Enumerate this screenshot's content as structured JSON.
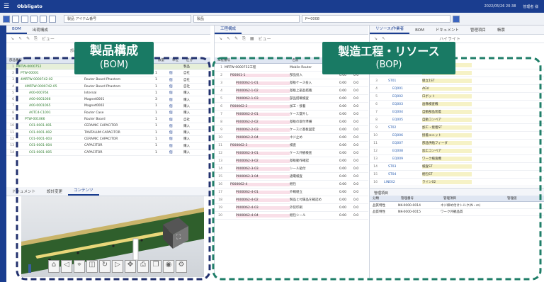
{
  "app": {
    "brand": "Obbligato",
    "status_right": [
      "2022/05/26 20:38",
      "管理者 様"
    ]
  },
  "toolbar": {
    "field1": "製品 アイテム番号",
    "field2": "製品",
    "field3": "P=0008"
  },
  "bom": {
    "tabs": [
      "BOM",
      "出荷構成"
    ],
    "filter_label": "ビュー",
    "section_label": "部品構成",
    "columns": [
      "部品番号",
      "名前",
      "数量",
      "単位",
      "区分"
    ],
    "rows": [
      {
        "n": "1",
        "name": "MRTW-0000752",
        "desc": "",
        "qty": "",
        "unit": "",
        "type": "製品"
      },
      {
        "n": "2",
        "name": "PTW-00001",
        "desc": "Router Lid",
        "qty": "1",
        "unit": "個",
        "type": "自社"
      },
      {
        "n": "3",
        "name": "4MRTW-0000742-02",
        "desc": "Router Board Phantom",
        "qty": "1",
        "unit": "個",
        "type": "自社"
      },
      {
        "n": "4",
        "name": "4MRTW-0000742-05",
        "desc": "Router Board Phantom",
        "qty": "1",
        "unit": "個",
        "type": "自社"
      },
      {
        "n": "5",
        "name": "A00-000764",
        "desc": "Internal",
        "qty": "1",
        "unit": "個",
        "type": "購入"
      },
      {
        "n": "6",
        "name": "A00-0001066",
        "desc": "Magnet0001",
        "qty": "3",
        "unit": "個",
        "type": "購入"
      },
      {
        "n": "7",
        "name": "A00-0001065",
        "desc": "Magnet0002",
        "qty": "1",
        "unit": "個",
        "type": "購入"
      },
      {
        "n": "8",
        "name": "A0TC4-C1001",
        "desc": "Router Case",
        "qty": "1",
        "unit": "個",
        "type": "購入"
      },
      {
        "n": "9",
        "name": "PTW-001066",
        "desc": "Router Board",
        "qty": "1",
        "unit": "個",
        "type": "自社"
      },
      {
        "n": "10",
        "name": "C01-0001-001",
        "desc": "CERAMIC CAPACITOR",
        "qty": "1",
        "unit": "個",
        "type": "購入"
      },
      {
        "n": "11",
        "name": "C01-0001-002",
        "desc": "TANTALUM CAPACITOR",
        "qty": "1",
        "unit": "個",
        "type": "購入"
      },
      {
        "n": "12",
        "name": "C01-0001-003",
        "desc": "CERAMIC CAPACITOR",
        "qty": "1",
        "unit": "個",
        "type": "購入"
      },
      {
        "n": "13",
        "name": "C01-0001-004",
        "desc": "CAPACITOR",
        "qty": "1",
        "unit": "個",
        "type": "購入"
      },
      {
        "n": "14",
        "name": "C01-0001-005",
        "desc": "CAPACITOR",
        "qty": "1",
        "unit": "個",
        "type": "購入"
      }
    ],
    "bottom_tabs": [
      "ドキュメント",
      "設計変更",
      "コンテンツ"
    ]
  },
  "process": {
    "tab": "工程構成",
    "filter_label": "ビュー",
    "columns": [
      "工程番号",
      "名前",
      "作業時間",
      "標準時間"
    ],
    "rows": [
      {
        "n": "1",
        "name": "MRTW-0000752工程",
        "desc": "Mobile Router",
        "a": "",
        "b": ""
      },
      {
        "n": "2",
        "name": "P00001-1",
        "desc": "部品投入",
        "a": "0.00",
        "b": "0.0"
      },
      {
        "n": "3",
        "name": "P000062-1-01",
        "desc": "基板ケース投入",
        "a": "0.00",
        "b": "0.0"
      },
      {
        "n": "4",
        "name": "P000062-1-02",
        "desc": "基板上部品搭載",
        "a": "0.00",
        "b": "0.0"
      },
      {
        "n": "5",
        "name": "P000062-1-03",
        "desc": "部品搭載検査",
        "a": "0.00",
        "b": "0.0"
      },
      {
        "n": "6",
        "name": "P000062-2",
        "desc": "加工・接着",
        "a": "0.00",
        "b": "0.0"
      },
      {
        "n": "7",
        "name": "P000062-2-01",
        "desc": "ケース蓋外し",
        "a": "0.00",
        "b": "0.0"
      },
      {
        "n": "8",
        "name": "P000062-2-02",
        "desc": "基板の取付準備",
        "a": "0.00",
        "b": "0.0"
      },
      {
        "n": "9",
        "name": "P000062-2-03",
        "desc": "ケースに基板固定",
        "a": "0.00",
        "b": "0.0"
      },
      {
        "n": "10",
        "name": "P000062-2-04",
        "desc": "ネジ止め",
        "a": "0.00",
        "b": "0.0"
      },
      {
        "n": "11",
        "name": "P000062-3",
        "desc": "検査",
        "a": "0.00",
        "b": "0.0"
      },
      {
        "n": "12",
        "name": "P000062-3-01",
        "desc": "ケース外観検査",
        "a": "0.00",
        "b": "0.0"
      },
      {
        "n": "13",
        "name": "P000062-3-02",
        "desc": "基板動作確認",
        "a": "0.00",
        "b": "0.0"
      },
      {
        "n": "14",
        "name": "P000062-3-03",
        "desc": "シール貼付",
        "a": "0.00",
        "b": "0.0"
      },
      {
        "n": "15",
        "name": "P000062-3-04",
        "desc": "通電検査",
        "a": "0.00",
        "b": "0.0"
      },
      {
        "n": "16",
        "name": "P000062-4",
        "desc": "梱包",
        "a": "0.00",
        "b": "0.0"
      },
      {
        "n": "17",
        "name": "P000062-4-01",
        "desc": "外箱組立",
        "a": "0.00",
        "b": "0.0"
      },
      {
        "n": "18",
        "name": "P000062-4-02",
        "desc": "製品と付属品を箱詰め",
        "a": "0.00",
        "b": "0.0"
      },
      {
        "n": "19",
        "name": "P000062-4-03",
        "desc": "外装印刷",
        "a": "0.00",
        "b": "0.0"
      },
      {
        "n": "20",
        "name": "P000062-4-04",
        "desc": "梱包シール",
        "a": "0.00",
        "b": "0.0"
      }
    ]
  },
  "resource": {
    "tabs": [
      "リソース/作業者",
      "BOM",
      "ドキュメント",
      "管理項目",
      "帳票"
    ],
    "highlight": "ハイライト",
    "rows": [
      {
        "n": "1",
        "name": "",
        "desc": "工場"
      },
      {
        "n": "2",
        "name": "LINE01",
        "desc": "ライン01"
      },
      {
        "n": "3",
        "name": "ST01",
        "desc": "組立1ST"
      },
      {
        "n": "4",
        "name": "EQ001",
        "desc": "AGV"
      },
      {
        "n": "5",
        "name": "EQ002",
        "desc": "ロボット"
      },
      {
        "n": "6",
        "name": "EQ003",
        "desc": "画像検査機"
      },
      {
        "n": "7",
        "name": "EQ004",
        "desc": "自動部品装着"
      },
      {
        "n": "8",
        "name": "EQ005",
        "desc": "自動コンベア"
      },
      {
        "n": "9",
        "name": "ST02",
        "desc": "加工・接着ST"
      },
      {
        "n": "10",
        "name": "EQ006",
        "desc": "接着ユニット"
      },
      {
        "n": "11",
        "name": "EQ007",
        "desc": "部品供給フィーダ"
      },
      {
        "n": "12",
        "name": "EQ008",
        "desc": "加工コンベア"
      },
      {
        "n": "13",
        "name": "EQ009",
        "desc": "ワーク検査機"
      },
      {
        "n": "14",
        "name": "ST03",
        "desc": "検査ST"
      },
      {
        "n": "15",
        "name": "ST04",
        "desc": "梱包ST"
      },
      {
        "n": "16",
        "name": "LINE02",
        "desc": "ライン02"
      }
    ],
    "lower_title": "管理項目",
    "lower_columns": [
      "分類",
      "管理番号",
      "管理項目",
      "管理値"
    ],
    "lower_rows": [
      {
        "cat": "品質特性",
        "code": "NK-0000-0014",
        "item": "ネジ締め付けトルク(N・m)"
      },
      {
        "cat": "品質特性",
        "code": "NK-0000-0015",
        "item": "ワーク外観品質"
      }
    ]
  },
  "callouts": {
    "bom_line1": "製品構成",
    "bom_line2": "(BOM)",
    "bop_line1": "製造工程・リソース",
    "bop_line2": "(BOP)"
  },
  "colors": {
    "nav": "#1a3d8f",
    "callout": "#197a64",
    "bom_border": "#22316e",
    "bop_border": "#1f7e68"
  }
}
